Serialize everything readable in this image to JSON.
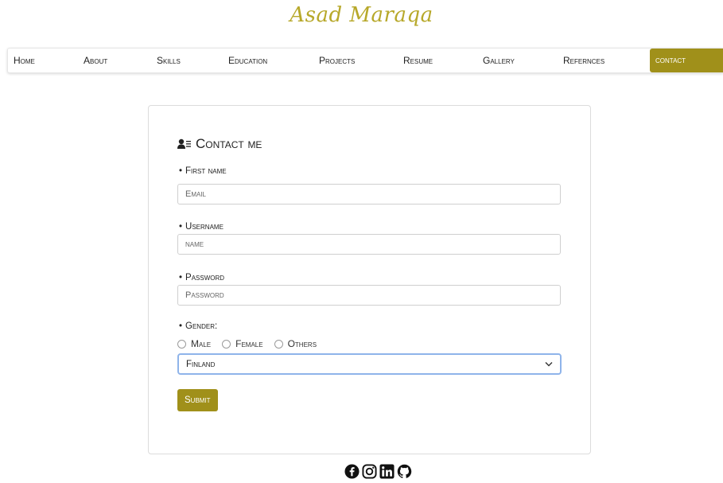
{
  "brand": {
    "name": "Asad Maraqa"
  },
  "nav": {
    "items": [
      {
        "label": "Home"
      },
      {
        "label": "About"
      },
      {
        "label": "Skills"
      },
      {
        "label": "Education"
      },
      {
        "label": "Projects"
      },
      {
        "label": "Resume"
      },
      {
        "label": "Gallery"
      },
      {
        "label": "Refernces"
      },
      {
        "label": "contact",
        "active": true
      }
    ]
  },
  "form": {
    "title": "Contact me",
    "title_icon": "user-list-icon",
    "first_name": {
      "label": "First name",
      "placeholder": "Email"
    },
    "username": {
      "label": "Username",
      "placeholder": "name"
    },
    "password": {
      "label": "Password",
      "placeholder": "Password"
    },
    "gender": {
      "label": "Gender:",
      "options": [
        "Male",
        "Female",
        "Others"
      ]
    },
    "country": {
      "selected": "Finland"
    },
    "submit_label": "Submit"
  },
  "social": {
    "icons": [
      "facebook-icon",
      "instagram-icon",
      "linkedin-icon",
      "github-icon"
    ]
  },
  "colors": {
    "accent": "#a0901a",
    "brand": "#b7a82a",
    "focus": "#8fb4ea"
  }
}
